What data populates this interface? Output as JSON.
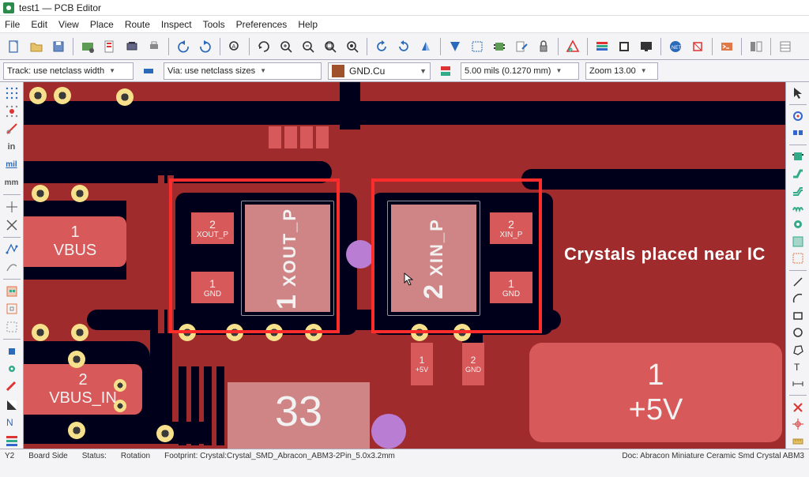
{
  "title": "test1 — PCB Editor",
  "menu": {
    "file": "File",
    "edit": "Edit",
    "view": "View",
    "place": "Place",
    "route": "Route",
    "inspect": "Inspect",
    "tools": "Tools",
    "preferences": "Preferences",
    "help": "Help"
  },
  "dropdowns": {
    "track": "Track: use netclass width",
    "via": "Via: use netclass sizes",
    "layer": "GND.Cu",
    "grid": "5.00 mils (0.1270 mm)",
    "zoom": "Zoom 13.00"
  },
  "left_sidebar": {
    "in": "in",
    "mil": "mil",
    "mm": "mm"
  },
  "canvas": {
    "comp_left": {
      "big": "1",
      "label": "XOUT_P",
      "pad_tl_num": "2",
      "pad_tl_net": "XOUT_P",
      "pad_bl_num": "1",
      "pad_bl_net": "GND"
    },
    "comp_right": {
      "big": "2",
      "label": "XIN_P",
      "pad_tr_num": "2",
      "pad_tr_net": "XIN_P",
      "pad_br_num": "1",
      "pad_br_net": "GND"
    },
    "vbus": {
      "n": "1",
      "net": "VBUS"
    },
    "vbus_in": {
      "n": "2",
      "net": "VBUS_IN"
    },
    "plus5": {
      "n": "1",
      "net": "+5V"
    },
    "ic": "33",
    "small_pads": {
      "p5v_num": "1",
      "p5v_net": "+5V",
      "gnd_num": "2",
      "gnd_net": "GND"
    },
    "annot": "Crystals placed near IC"
  },
  "status": {
    "y_label": "Y2",
    "y_val": "",
    "side_label": "Board Side",
    "side_val": "",
    "status_label": "Status:",
    "status_val": "",
    "rot_label": "Rotation",
    "fp_label": "Footprint: Crystal:Crystal_SMD_Abracon_ABM3-2Pin_5.0x3.2mm",
    "doc_label": "Doc: Abracon Miniature Ceramic Smd Crystal ABM3"
  }
}
